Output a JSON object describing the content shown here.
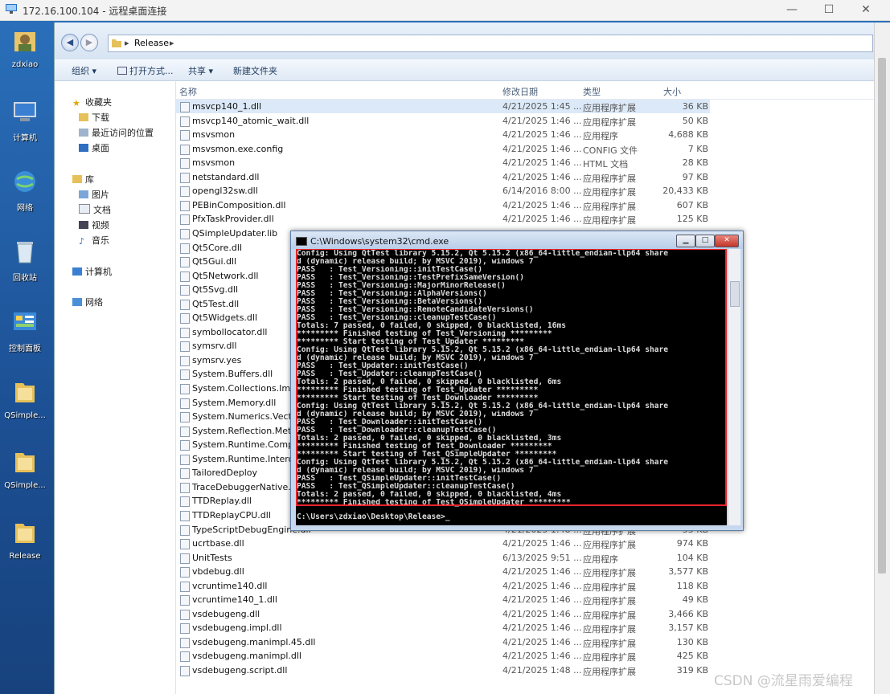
{
  "rdp": {
    "title": "172.16.100.104 - 远程桌面连接",
    "min": "—",
    "max": "☐",
    "close": "✕"
  },
  "desktop_icons": [
    {
      "label": "zdxiao"
    },
    {
      "label": "计算机"
    },
    {
      "label": "网络"
    },
    {
      "label": "回收站"
    },
    {
      "label": "控制面板"
    },
    {
      "label": "QSimple..."
    },
    {
      "label": "QSimple..."
    },
    {
      "label": "Release"
    }
  ],
  "explorer": {
    "path": "Release",
    "toolbar": {
      "organize": "组织 ▾",
      "open": "打开方式...",
      "share": "共享 ▾",
      "new_folder": "新建文件夹"
    },
    "nav": [
      {
        "label": "收藏夹"
      },
      {
        "label": "下载"
      },
      {
        "label": "最近访问的位置"
      },
      {
        "label": "桌面"
      },
      {
        "label": "库"
      },
      {
        "label": "图片"
      },
      {
        "label": "文档"
      },
      {
        "label": "视频"
      },
      {
        "label": "音乐"
      },
      {
        "label": "计算机"
      },
      {
        "label": "网络"
      }
    ],
    "columns": {
      "name": "名称",
      "date": "修改日期",
      "type": "类型",
      "size": "大小"
    },
    "files": [
      {
        "name": "msvcp140_1.dll",
        "date": "4/21/2025 1:45 ...",
        "type": "应用程序扩展",
        "size": "36 KB"
      },
      {
        "name": "msvcp140_atomic_wait.dll",
        "date": "4/21/2025 1:46 ...",
        "type": "应用程序扩展",
        "size": "50 KB"
      },
      {
        "name": "msvsmon",
        "date": "4/21/2025 1:46 ...",
        "type": "应用程序",
        "size": "4,688 KB"
      },
      {
        "name": "msvsmon.exe.config",
        "date": "4/21/2025 1:46 ...",
        "type": "CONFIG 文件",
        "size": "7 KB"
      },
      {
        "name": "msvsmon",
        "date": "4/21/2025 1:46 ...",
        "type": "HTML 文档",
        "size": "28 KB"
      },
      {
        "name": "netstandard.dll",
        "date": "4/21/2025 1:46 ...",
        "type": "应用程序扩展",
        "size": "97 KB"
      },
      {
        "name": "opengl32sw.dll",
        "date": "6/14/2016 8:00 ...",
        "type": "应用程序扩展",
        "size": "20,433 KB"
      },
      {
        "name": "PEBinComposition.dll",
        "date": "4/21/2025 1:46 ...",
        "type": "应用程序扩展",
        "size": "607 KB"
      },
      {
        "name": "PfxTaskProvider.dll",
        "date": "4/21/2025 1:46 ...",
        "type": "应用程序扩展",
        "size": "125 KB"
      },
      {
        "name": "QSimpleUpdater.lib",
        "date": "",
        "type": "",
        "size": ""
      },
      {
        "name": "Qt5Core.dll",
        "date": "",
        "type": "",
        "size": ""
      },
      {
        "name": "Qt5Gui.dll",
        "date": "",
        "type": "",
        "size": ""
      },
      {
        "name": "Qt5Network.dll",
        "date": "",
        "type": "",
        "size": ""
      },
      {
        "name": "Qt5Svg.dll",
        "date": "",
        "type": "",
        "size": ""
      },
      {
        "name": "Qt5Test.dll",
        "date": "",
        "type": "",
        "size": ""
      },
      {
        "name": "Qt5Widgets.dll",
        "date": "",
        "type": "",
        "size": ""
      },
      {
        "name": "symbollocator.dll",
        "date": "",
        "type": "",
        "size": ""
      },
      {
        "name": "symsrv.dll",
        "date": "",
        "type": "",
        "size": ""
      },
      {
        "name": "symsrv.yes",
        "date": "",
        "type": "",
        "size": ""
      },
      {
        "name": "System.Buffers.dll",
        "date": "",
        "type": "",
        "size": ""
      },
      {
        "name": "System.Collections.Immut",
        "date": "",
        "type": "",
        "size": ""
      },
      {
        "name": "System.Memory.dll",
        "date": "",
        "type": "",
        "size": ""
      },
      {
        "name": "System.Numerics.Vectors",
        "date": "",
        "type": "",
        "size": ""
      },
      {
        "name": "System.Reflection.Metada",
        "date": "",
        "type": "",
        "size": ""
      },
      {
        "name": "System.Runtime.Compiler",
        "date": "",
        "type": "",
        "size": ""
      },
      {
        "name": "System.Runtime.InteropS",
        "date": "",
        "type": "",
        "size": ""
      },
      {
        "name": "TailoredDeploy",
        "date": "",
        "type": "",
        "size": ""
      },
      {
        "name": "TraceDebuggerNative.dll",
        "date": "",
        "type": "",
        "size": ""
      },
      {
        "name": "TTDReplay.dll",
        "date": "",
        "type": "",
        "size": ""
      },
      {
        "name": "TTDReplayCPU.dll",
        "date": "",
        "type": "",
        "size": ""
      },
      {
        "name": "TypeScriptDebugEngine.dll",
        "date": "4/21/2025 1:48 ...",
        "type": "应用程序扩展",
        "size": "55 KB"
      },
      {
        "name": "ucrtbase.dll",
        "date": "4/21/2025 1:46 ...",
        "type": "应用程序扩展",
        "size": "974 KB"
      },
      {
        "name": "UnitTests",
        "date": "6/13/2025 9:51 ...",
        "type": "应用程序",
        "size": "104 KB"
      },
      {
        "name": "vbdebug.dll",
        "date": "4/21/2025 1:46 ...",
        "type": "应用程序扩展",
        "size": "3,577 KB"
      },
      {
        "name": "vcruntime140.dll",
        "date": "4/21/2025 1:46 ...",
        "type": "应用程序扩展",
        "size": "118 KB"
      },
      {
        "name": "vcruntime140_1.dll",
        "date": "4/21/2025 1:46 ...",
        "type": "应用程序扩展",
        "size": "49 KB"
      },
      {
        "name": "vsdebugeng.dll",
        "date": "4/21/2025 1:46 ...",
        "type": "应用程序扩展",
        "size": "3,466 KB"
      },
      {
        "name": "vsdebugeng.impl.dll",
        "date": "4/21/2025 1:46 ...",
        "type": "应用程序扩展",
        "size": "3,157 KB"
      },
      {
        "name": "vsdebugeng.manimpl.45.dll",
        "date": "4/21/2025 1:46 ...",
        "type": "应用程序扩展",
        "size": "130 KB"
      },
      {
        "name": "vsdebugeng.manimpl.dll",
        "date": "4/21/2025 1:46 ...",
        "type": "应用程序扩展",
        "size": "425 KB"
      },
      {
        "name": "vsdebugeng.script.dll",
        "date": "4/21/2025 1:48 ...",
        "type": "应用程序扩展",
        "size": "319 KB"
      }
    ]
  },
  "cmd": {
    "title": "C:\\Windows\\system32\\cmd.exe",
    "lines": [
      "Config: Using QtTest library 5.15.2, Qt 5.15.2 (x86_64-little_endian-llp64 share",
      "d (dynamic) release build; by MSVC 2019), windows 7",
      "PASS   : Test_Versioning::initTestCase()",
      "PASS   : Test_Versioning::TestPrefixSameVersion()",
      "PASS   : Test_Versioning::MajorMinorRelease()",
      "PASS   : Test_Versioning::AlphaVersions()",
      "PASS   : Test_Versioning::BetaVersions()",
      "PASS   : Test_Versioning::RemoteCandidateVersions()",
      "PASS   : Test_Versioning::cleanupTestCase()",
      "Totals: 7 passed, 0 failed, 0 skipped, 0 blacklisted, 16ms",
      "********* Finished testing of Test_Versioning *********",
      "********* Start testing of Test_Updater *********",
      "Config: Using QtTest library 5.15.2, Qt 5.15.2 (x86_64-little_endian-llp64 share",
      "d (dynamic) release build; by MSVC 2019), windows 7",
      "PASS   : Test_Updater::initTestCase()",
      "PASS   : Test_Updater::cleanupTestCase()",
      "Totals: 2 passed, 0 failed, 0 skipped, 0 blacklisted, 6ms",
      "********* Finished testing of Test_Updater *********",
      "********* Start testing of Test_Downloader *********",
      "Config: Using QtTest library 5.15.2, Qt 5.15.2 (x86_64-little_endian-llp64 share",
      "d (dynamic) release build; by MSVC 2019), windows 7",
      "PASS   : Test_Downloader::initTestCase()",
      "PASS   : Test_Downloader::cleanupTestCase()",
      "Totals: 2 passed, 0 failed, 0 skipped, 0 blacklisted, 3ms",
      "********* Finished testing of Test_Downloader *********",
      "********* Start testing of Test_QSimpleUpdater *********",
      "Config: Using QtTest library 5.15.2, Qt 5.15.2 (x86_64-little_endian-llp64 share",
      "d (dynamic) release build; by MSVC 2019), windows 7",
      "PASS   : Test_QSimpleUpdater::initTestCase()",
      "PASS   : Test_QSimpleUpdater::cleanupTestCase()",
      "Totals: 2 passed, 0 failed, 0 skipped, 0 blacklisted, 4ms",
      "********* Finished testing of Test_QSimpleUpdater *********"
    ],
    "prompt": "C:\\Users\\zdxiao\\Desktop\\Release>_"
  },
  "watermark": "CSDN @流星雨爱编程"
}
